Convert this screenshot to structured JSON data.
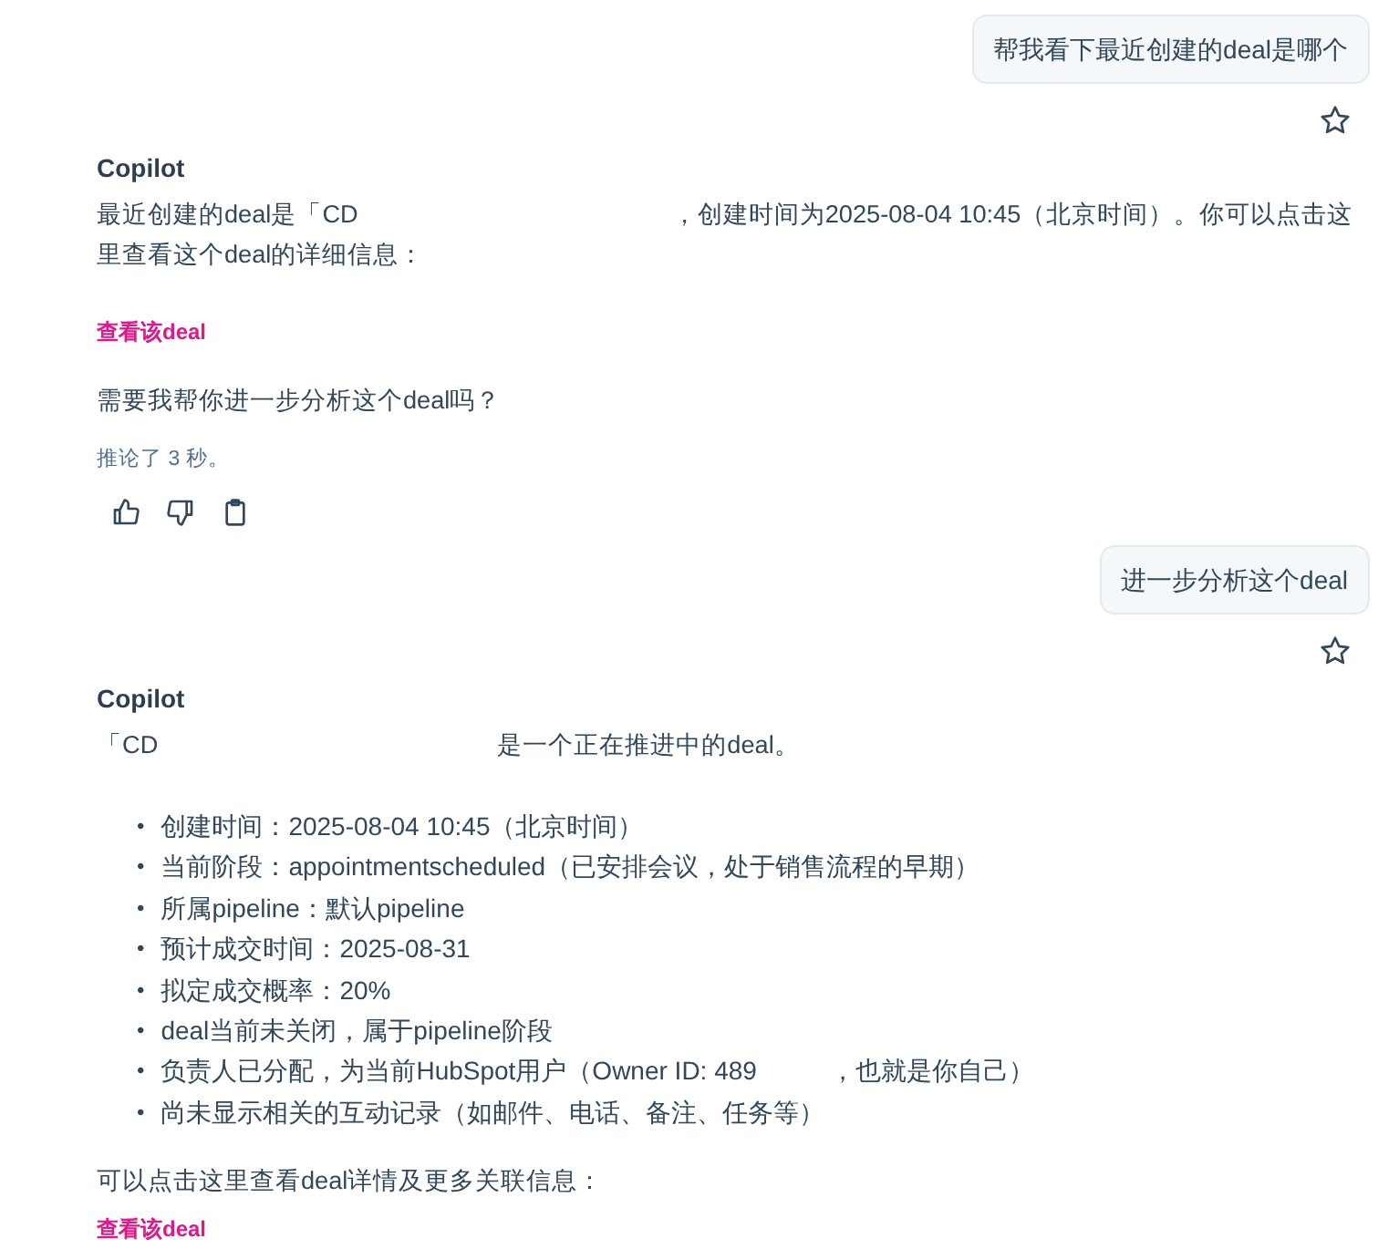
{
  "messages": [
    {
      "kind": "user",
      "text": "帮我看下最近创建的deal是哪个",
      "starred": false
    },
    {
      "kind": "assistant",
      "author": "Copilot",
      "blocks": [
        {
          "kind": "paragraph",
          "parts": [
            "最近创建的deal是「CD",
            "，创建时间为2025-08-04 10:45（北京时间）。你可以点击这里查看这个deal的详细信息："
          ]
        },
        {
          "kind": "link",
          "text": "查看该deal"
        },
        {
          "kind": "paragraph",
          "parts": [
            "需要我帮你进一步分析这个deal吗？"
          ]
        }
      ],
      "reasoning": "推论了 3 秒。"
    },
    {
      "kind": "user",
      "text": "进一步分析这个deal",
      "starred": false
    },
    {
      "kind": "assistant",
      "author": "Copilot",
      "blocks": [
        {
          "kind": "paragraph",
          "parts": [
            "「CD",
            "是一个正在推进中的deal。"
          ]
        },
        {
          "kind": "list",
          "marker": "•",
          "items": [
            {
              "parts": [
                "创建时间：2025-08-04 10:45（北京时间）"
              ]
            },
            {
              "parts": [
                "当前阶段：appointmentscheduled（已安排会议，处于销售流程的早期）"
              ]
            },
            {
              "parts": [
                "所属pipeline：默认pipeline"
              ]
            },
            {
              "parts": [
                "预计成交时间：2025-08-31"
              ]
            },
            {
              "parts": [
                "拟定成交概率：20%"
              ]
            },
            {
              "parts": [
                "deal当前未关闭，属于pipeline阶段"
              ]
            },
            {
              "parts": [
                "负责人已分配，为当前HubSpot用户（Owner ID: 489",
                "，也就是你自己）"
              ]
            },
            {
              "parts": [
                "尚未显示相关的互动记录（如邮件、电话、备注、任务等）"
              ]
            }
          ]
        },
        {
          "kind": "paragraph",
          "parts": [
            "可以点击这里查看deal详情及更多关联信息："
          ]
        },
        {
          "kind": "link",
          "text": "查看该deal"
        }
      ]
    }
  ]
}
